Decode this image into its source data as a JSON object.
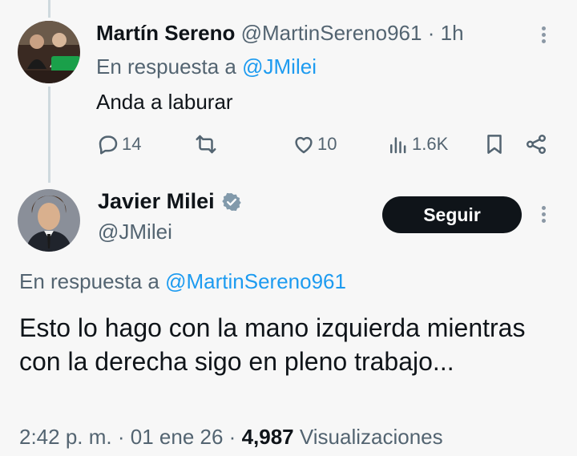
{
  "reply_tweet": {
    "author_name": "Martín Sereno",
    "handle": "@MartinSereno961",
    "separator": "·",
    "time": "1h",
    "reply_prefix": "En respuesta a",
    "reply_to": "@JMilei",
    "text": "Anda a laburar",
    "actions": {
      "replies": "14",
      "likes": "10",
      "views": "1.6K"
    }
  },
  "main_tweet": {
    "author_name": "Javier Milei",
    "handle": "@JMilei",
    "follow_label": "Seguir",
    "reply_prefix": "En respuesta a",
    "reply_to": "@MartinSereno961",
    "text": "Esto lo hago con la mano izquierda mientras con la derecha sigo en pleno trabajo...",
    "time": "2:42 p. m.",
    "date": "01 ene 26",
    "separator": "·",
    "views_count": "4,987",
    "views_label": "Visualizaciones"
  },
  "colors": {
    "accent": "#1d9bf0",
    "text": "#0f1419",
    "muted": "#536471",
    "background": "#f7f7f7",
    "follow_button": "#0f1419"
  },
  "icons": [
    "reply-icon",
    "retweet-icon",
    "like-icon",
    "views-icon",
    "bookmark-icon",
    "share-icon",
    "verified-badge-icon",
    "more-options-icon"
  ]
}
